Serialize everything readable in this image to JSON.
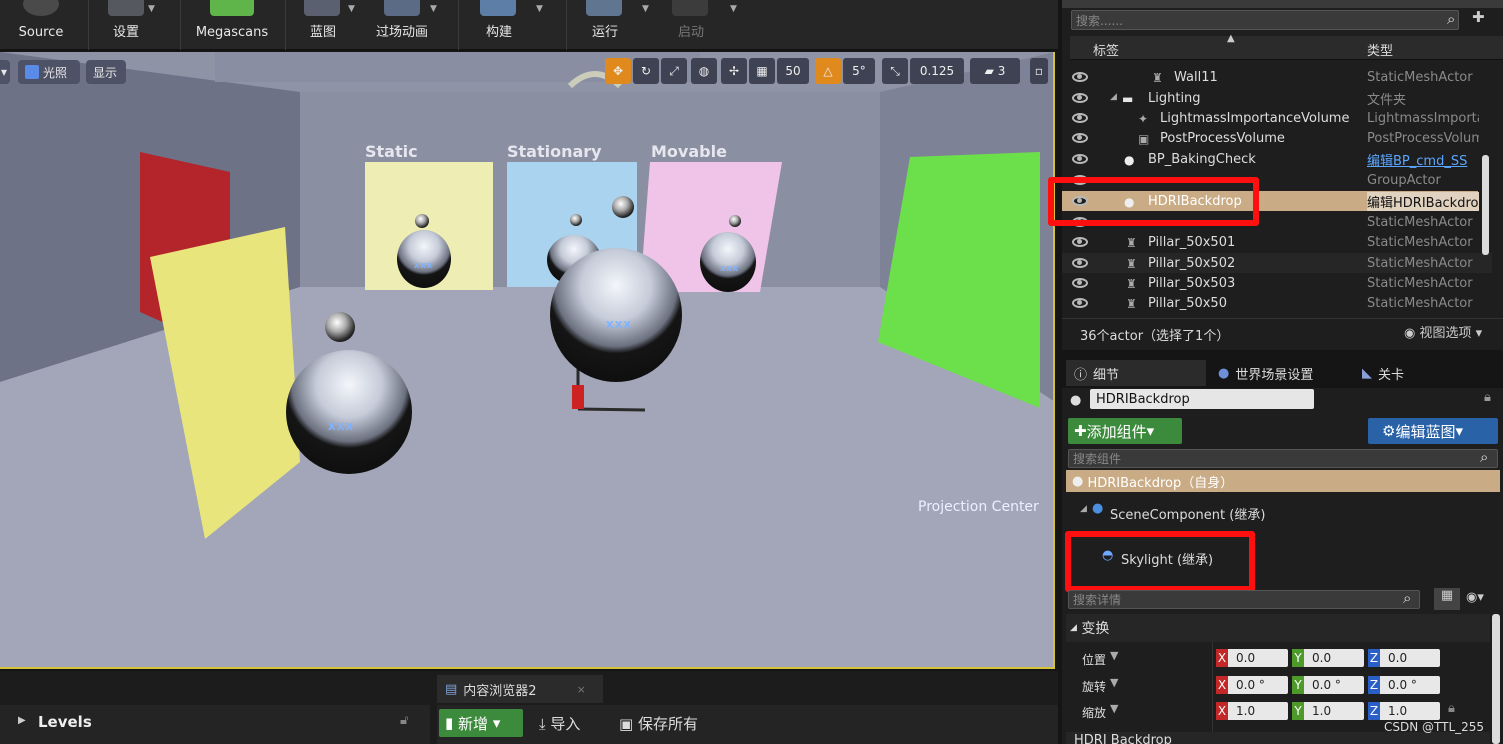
{
  "toolbar": {
    "items": [
      {
        "label": "Source"
      },
      {
        "label": "设置"
      },
      {
        "label": "Megascans"
      },
      {
        "label": "蓝图"
      },
      {
        "label": "过场动画"
      },
      {
        "label": "构建"
      },
      {
        "label": "运行"
      },
      {
        "label": "启动"
      }
    ]
  },
  "viewport": {
    "btn_lighting": "光照",
    "btn_show": "显示",
    "grid_size": "50",
    "rot_snap": "5°",
    "scale_snap": "0.125",
    "cam_speed": "3",
    "wall_labels": [
      "Static",
      "Stationary",
      "Movable"
    ],
    "sphere_text": "XXX",
    "projection_label": "Projection Center"
  },
  "outliner": {
    "search_placeholder": "搜索......",
    "col_label": "标签",
    "col_type": "类型",
    "rows": [
      {
        "label": "Wall11",
        "type": "StaticMeshActor",
        "indent": 1
      },
      {
        "label": "Lighting",
        "type": "文件夹",
        "indent": 0
      },
      {
        "label": "LightmassImportanceVolume",
        "type": "LightmassImportanceVolume",
        "indent": 2
      },
      {
        "label": "PostProcessVolume",
        "type": "PostProcessVolume",
        "indent": 2
      },
      {
        "label": "BP_BakingCheck",
        "type": "编辑BP_cmd_SS",
        "indent": 1
      },
      {
        "label": "",
        "type": "GroupActor",
        "indent": 1
      },
      {
        "label": "HDRIBackdrop",
        "type": "编辑HDRIBackdrop",
        "indent": 1
      },
      {
        "label": "",
        "type": "StaticMeshActor",
        "indent": 1
      },
      {
        "label": "Pillar_50x501",
        "type": "StaticMeshActor",
        "indent": 1
      },
      {
        "label": "Pillar_50x502",
        "type": "StaticMeshActor",
        "indent": 1
      },
      {
        "label": "Pillar_50x503",
        "type": "StaticMeshActor",
        "indent": 1
      },
      {
        "label": "Pillar_50x50",
        "type": "StaticMeshActor",
        "indent": 1
      }
    ],
    "status": "36个actor（选择了1个）",
    "view_options": "视图选项"
  },
  "details": {
    "tabs": [
      "细节",
      "世界场景设置",
      "关卡"
    ],
    "name_value": "HDRIBackdrop",
    "add_component": "添加组件",
    "edit_blueprint": "编辑蓝图",
    "search_component_placeholder": "搜索组件",
    "self_row": "HDRIBackdrop（自身）",
    "scene_component": "SceneComponent (继承)",
    "skylight": "Skylight (继承)",
    "search_details_placeholder": "搜索详情",
    "transform": "变换",
    "transform_rows": [
      {
        "label": "位置",
        "x": "0.0",
        "y": "0.0",
        "z": "0.0"
      },
      {
        "label": "旋转",
        "x": "0.0 °",
        "y": "0.0 °",
        "z": "0.0 °"
      },
      {
        "label": "缩放",
        "x": "1.0",
        "y": "1.0",
        "z": "1.0"
      }
    ],
    "next_section": "HDRI Backdrop"
  },
  "bottom": {
    "levels": "Levels",
    "tab": "内容浏览器2",
    "new_btn": "新增",
    "import_btn": "导入",
    "save_all": "保存所有"
  },
  "watermark": "CSDN @TTL_255"
}
